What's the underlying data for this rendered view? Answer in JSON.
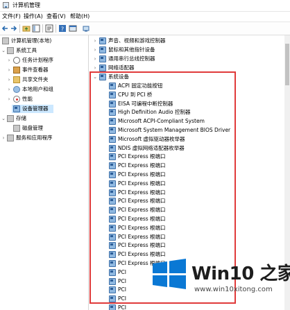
{
  "window": {
    "title": "计算机管理"
  },
  "menu": [
    "文件(F)",
    "操作(A)",
    "查看(V)",
    "帮助(H)"
  ],
  "tree": {
    "root": "计算机管理(本地)",
    "system_tools": "系统工具",
    "task_scheduler": "任务计划程序",
    "event_viewer": "事件查看器",
    "shared_folders": "共享文件夹",
    "local_users": "本地用户和组",
    "performance": "性能",
    "device_manager": "设备管理器",
    "storage": "存储",
    "disk_management": "磁盘管理",
    "services_apps": "服务和应用程序"
  },
  "devices": {
    "top_categories": [
      "声音、视频和游戏控制器",
      "鼠标和其他指针设备",
      "通用串行总线控制器",
      "网络适配器"
    ],
    "system_devices_label": "系统设备",
    "system_devices": [
      "ACPI 固定功能按钮",
      "CPU 到 PCI 桥",
      "EISA 可编程中断控制器",
      "High Definition Audio 控制器",
      "Microsoft ACPI-Compliant System",
      "Microsoft System Management BIOS Driver",
      "Microsoft 虚拟驱动器枚举器",
      "NDIS 虚拟网络适配器枚举器",
      "PCI Express 根端口",
      "PCI Express 根端口",
      "PCI Express 根端口",
      "PCI Express 根端口",
      "PCI Express 根端口",
      "PCI Express 根端口",
      "PCI Express 根端口",
      "PCI Express 根端口",
      "PCI Express 根端口",
      "PCI Express 根端口",
      "PCI Express 根端口",
      "PCI Express 根端口",
      "PCI Express 根端口",
      "PCI",
      "PCI",
      "PCI",
      "PCI",
      "PCI",
      "PCI"
    ]
  },
  "watermark": {
    "title": "Win10 之家",
    "url": "www.win10xitong.com"
  },
  "colors": {
    "highlight": "#e03a3a",
    "selection": "#cce8ff",
    "logo_blue": "#0a78d4"
  }
}
